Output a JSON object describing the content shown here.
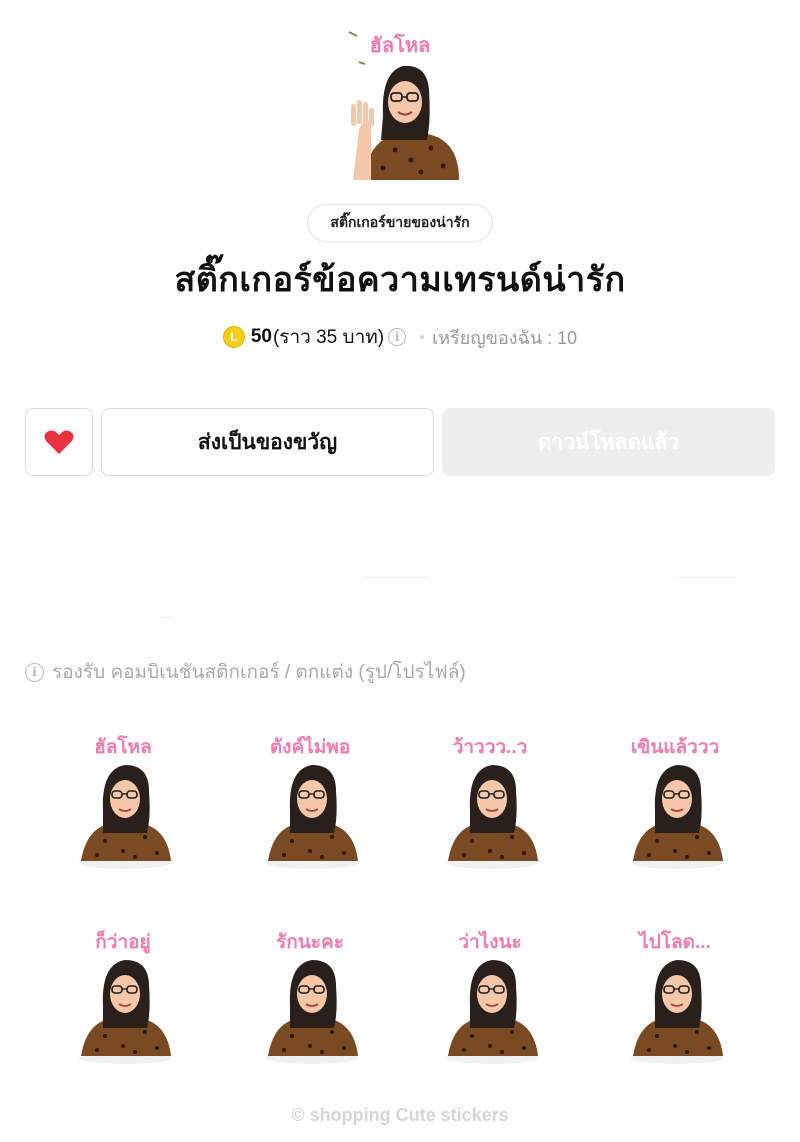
{
  "hero": {
    "caption": "ฮัลโหล",
    "icon": "waving-girl-sticker"
  },
  "tag": "สติ๊กเกอร์ขายของน่ารัก",
  "title": "สติ๊กเกอร์ข้อความเทรนด์น่ารัก",
  "price": {
    "coin_letter": "L",
    "coins": "50",
    "approx": "(ราว 35 บาท)",
    "info_icon": "i",
    "my_coins": "เหรียญของฉัน : 10"
  },
  "actions": {
    "heart_icon": "heart-icon",
    "gift_label": "ส่งเป็นของขวัญ",
    "download_label": "ดาวน์โหลดแล้ว"
  },
  "support": {
    "icon": "i",
    "text": "รองรับ คอมบิเนชันสติกเกอร์ / ตกแต่ง (รูป/โปรไฟล์)"
  },
  "stickers": [
    {
      "caption": "ฮัลโหล"
    },
    {
      "caption": "ตังค์ไม่พอ"
    },
    {
      "caption": "ว้าววว..ว"
    },
    {
      "caption": "เขินแล้ววว"
    },
    {
      "caption": "ก็ว่าอยู่"
    },
    {
      "caption": "รักนะคะ"
    },
    {
      "caption": "ว่าไงนะ"
    },
    {
      "caption": "ไปโลด..."
    }
  ],
  "footer": "© shopping Cute stickers",
  "colors": {
    "skin": "#f3c7a8",
    "hair": "#2a201b",
    "leopard": "#7a4a22",
    "caption": "#f07bb1",
    "heart": "#e8323f",
    "coin": "#f4cc1a"
  }
}
